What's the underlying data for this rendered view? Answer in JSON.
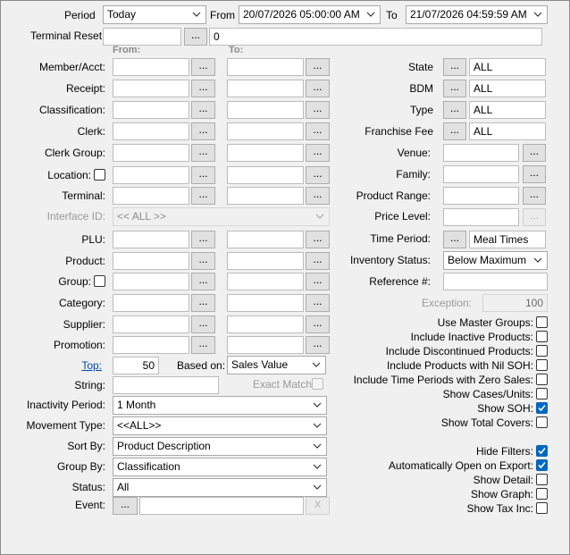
{
  "period": {
    "label": "Period",
    "value": "Today",
    "from_label": "From",
    "from_value": "20/07/2026 05:00:00 AM",
    "to_label": "To",
    "to_value": "21/07/2026 04:59:59 AM"
  },
  "terminal_reset": {
    "label": "Terminal Reset",
    "value": "",
    "count": "0"
  },
  "headers": {
    "from": "From:",
    "to": "To:"
  },
  "left_filters": [
    {
      "label": "Member/Acct:"
    },
    {
      "label": "Receipt:"
    },
    {
      "label": "Classification:"
    },
    {
      "label": "Clerk:"
    },
    {
      "label": "Clerk Group:"
    },
    {
      "label": "Location:"
    },
    {
      "label": "Terminal:"
    }
  ],
  "interface_id": {
    "label": "Interface ID:",
    "value": "<< ALL >>"
  },
  "left_filters2": [
    {
      "label": "PLU:"
    },
    {
      "label": "Product:"
    },
    {
      "label": "Group:"
    },
    {
      "label": "Category:"
    },
    {
      "label": "Supplier:"
    },
    {
      "label": "Promotion:"
    }
  ],
  "right_filters": [
    {
      "label": "State",
      "value": "ALL"
    },
    {
      "label": "BDM",
      "value": "ALL"
    },
    {
      "label": "Type",
      "value": "ALL"
    },
    {
      "label": "Franchise Fee",
      "value": "ALL"
    }
  ],
  "right_filters2": [
    {
      "label": "Venue:"
    },
    {
      "label": "Family:"
    },
    {
      "label": "Product Range:"
    }
  ],
  "price_level": {
    "label": "Price Level:"
  },
  "time_period": {
    "label": "Time Period:",
    "value": "Meal Times"
  },
  "inventory_status": {
    "label": "Inventory Status:",
    "value": "Below Maximum"
  },
  "reference": {
    "label": "Reference #:"
  },
  "exception": {
    "label": "Exception:",
    "value": "100"
  },
  "options": [
    {
      "label": "Use Master Groups:",
      "checked": false
    },
    {
      "label": "Include Inactive Products:",
      "checked": false
    },
    {
      "label": "Include Discontinued Products:",
      "checked": false
    },
    {
      "label": "Include Products with Nil SOH:",
      "checked": false
    },
    {
      "label": "Include Time Periods with Zero Sales:",
      "checked": false
    },
    {
      "label": "Show Cases/Units:",
      "checked": false
    },
    {
      "label": "Show SOH:",
      "checked": true
    },
    {
      "label": "Show Total Covers:",
      "checked": false
    }
  ],
  "options2": [
    {
      "label": "Hide Filters:",
      "checked": true
    },
    {
      "label": "Automatically Open on Export:",
      "checked": true
    },
    {
      "label": "Show Detail:",
      "checked": false
    },
    {
      "label": "Show Graph:",
      "checked": false
    },
    {
      "label": "Show Tax Inc:",
      "checked": false
    }
  ],
  "top": {
    "label": "Top:",
    "value": "50",
    "based_on_label": "Based on:",
    "based_on_value": "Sales Value"
  },
  "string": {
    "label": "String:",
    "exact_match_label": "Exact Match:"
  },
  "inactivity": {
    "label": "Inactivity Period:",
    "value": "1 Month"
  },
  "movement": {
    "label": "Movement Type:",
    "value": "<<ALL>>"
  },
  "sort_by": {
    "label": "Sort By:",
    "value": "Product Description"
  },
  "group_by": {
    "label": "Group By:",
    "value": "Classification"
  },
  "status": {
    "label": "Status:",
    "value": "All"
  },
  "event": {
    "label": "Event:",
    "clear_label": "X"
  },
  "ellipsis": "..."
}
